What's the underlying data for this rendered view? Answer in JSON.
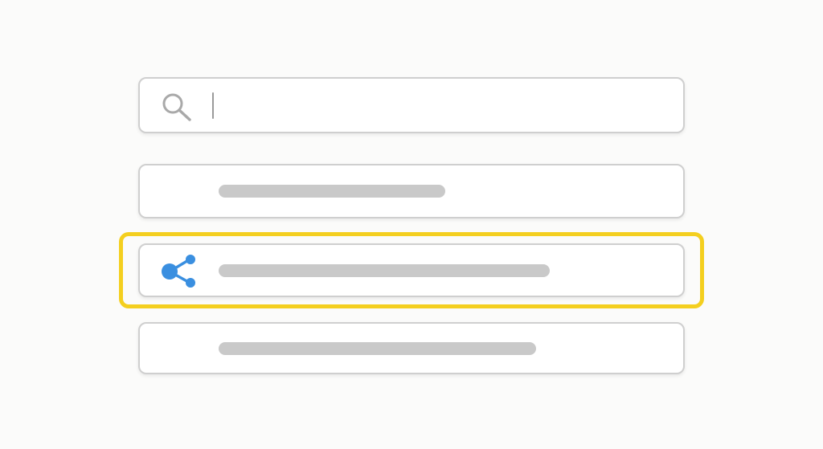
{
  "search": {
    "value": "",
    "placeholder": "",
    "icon": "search-icon"
  },
  "results": [
    {
      "label": "",
      "icon": null
    },
    {
      "label": "",
      "icon": "share-icon",
      "highlighted": true
    },
    {
      "label": "",
      "icon": null
    }
  ],
  "colors": {
    "background": "#fbfbfa",
    "border": "#cfcfcf",
    "placeholder_bar": "#c9c9c9",
    "highlight": "#f4cf1f",
    "share_icon": "#3a8fe0",
    "search_icon": "#a9a9a9"
  }
}
